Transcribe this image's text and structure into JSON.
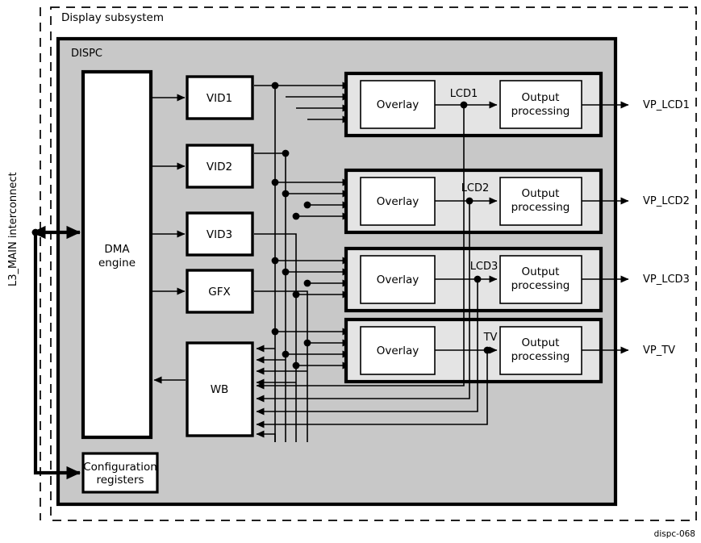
{
  "figure": {
    "tag": "dispc-068",
    "outer_label": "Display subsystem",
    "module_label": "DISPC",
    "bus_label": "L3_MAIN interconnect",
    "colors": {
      "dispc_fill": "#c8c8c8",
      "pipeline_fill": "#e4e4e4",
      "block_fill": "#ffffff",
      "stroke": "#000000",
      "page": "#ffffff"
    }
  },
  "blocks": {
    "dma": "DMA\nengine",
    "dma_line1": "DMA",
    "dma_line2": "engine",
    "config_line1": "Configuration",
    "config_line2": "registers",
    "wb": "WB",
    "overlay": "Overlay",
    "output_line1": "Output",
    "output_line2": "processing"
  },
  "sources": [
    {
      "label": "VID1"
    },
    {
      "label": "VID2"
    },
    {
      "label": "VID3"
    },
    {
      "label": "GFX"
    }
  ],
  "pipelines": [
    {
      "signal": "LCD1",
      "port": "VP_LCD1",
      "overlay": "Overlay",
      "output1": "Output",
      "output2": "processing"
    },
    {
      "signal": "LCD2",
      "port": "VP_LCD2",
      "overlay": "Overlay",
      "output1": "Output",
      "output2": "processing"
    },
    {
      "signal": "LCD3",
      "port": "VP_LCD3",
      "overlay": "Overlay",
      "output1": "Output",
      "output2": "processing"
    },
    {
      "signal": "TV",
      "port": "VP_TV",
      "overlay": "Overlay",
      "output1": "Output",
      "output2": "processing"
    }
  ]
}
